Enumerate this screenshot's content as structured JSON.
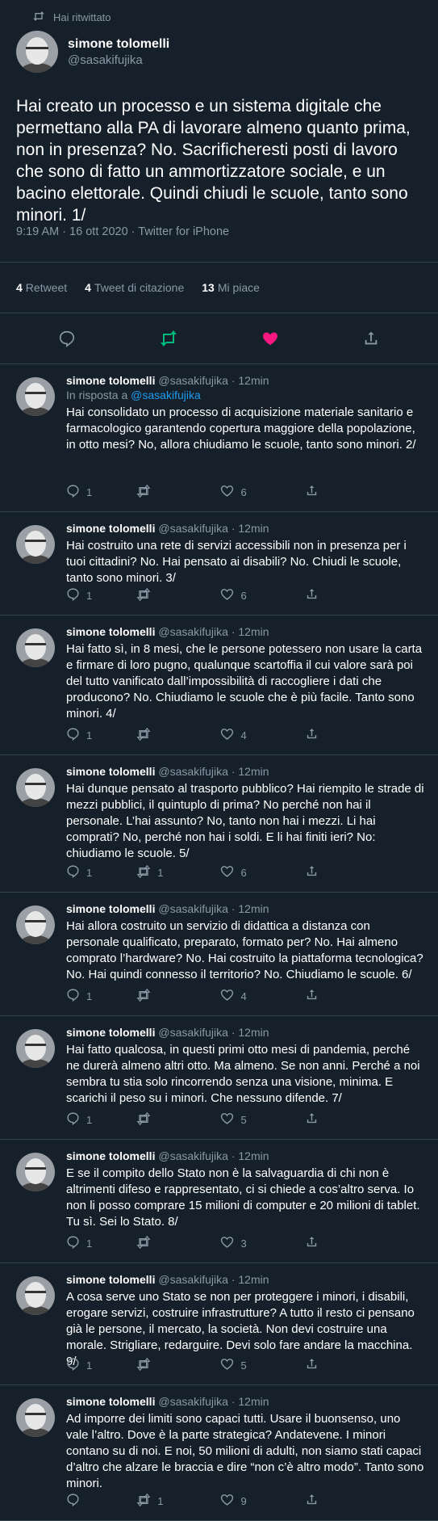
{
  "retweet_label": "Hai ritwittato",
  "main": {
    "name": "simone tolomelli",
    "handle": "@sasakifujika",
    "text": "Hai creato un processo e un sistema digitale che permettano alla PA di lavorare almeno quanto prima, non in presenza? No. Sacrificheresti posti di lavoro che sono di fatto un ammortizzatore sociale, e un bacino elettorale. Quindi chiudi le scuole, tanto sono minori. 1/",
    "meta": "9:19 AM · 16 ott 2020 · Twitter for iPhone",
    "retweets_count": "4",
    "retweets_label": "Retweet",
    "quotes_count": "4",
    "quotes_label": "Tweet di citazione",
    "likes_count": "13",
    "likes_label": "Mi piace"
  },
  "colors": {
    "background": "#15202b",
    "accent": "#1d9bf0",
    "like": "#f91880",
    "retweet_active": "#00ba7c"
  },
  "replies": [
    {
      "name": "simone tolomelli",
      "handle": "@sasakifujika",
      "time": "· 12min",
      "reply_to_prefix": "In risposta a",
      "reply_to_handle": "@sasakifujika",
      "text": "Hai consolidato un processo di acquisizione materiale sanitario e farmacologico garantendo copertura maggiore della popolazione, in otto mesi? No, allora chiudiamo le scuole, tanto sono minori. 2/",
      "replies": "1",
      "retweets": "",
      "likes": "6"
    },
    {
      "name": "simone tolomelli",
      "handle": "@sasakifujika",
      "time": "· 12min",
      "text": "Hai costruito una rete di servizi accessibili non in presenza per i tuoi cittadini? No. Hai pensato ai disabili? No.  Chiudi le scuole, tanto sono minori. 3/",
      "replies": "1",
      "retweets": "",
      "likes": "6"
    },
    {
      "name": "simone tolomelli",
      "handle": "@sasakifujika",
      "time": "· 12min",
      "text": "Hai fatto sì, in 8 mesi, che le persone potessero non usare la carta e firmare di loro pugno, qualunque scartoffia il cui valore sarà poi del tutto vanificato dall’impossibilità di raccogliere i dati che producono? No. Chiudiamo le scuole che è più facile. Tanto sono minori. 4/",
      "replies": "1",
      "retweets": "",
      "likes": "4"
    },
    {
      "name": "simone tolomelli",
      "handle": "@sasakifujika",
      "time": "· 12min",
      "text": "Hai dunque pensato al trasporto pubblico? Hai riempito le strade di mezzi pubblici, il quintuplo di prima? No perché non hai il personale. L’hai assunto? No, tanto non hai i mezzi. Li hai comprati? No, perché non hai i soldi. E li hai finiti ieri? No: chiudiamo le scuole. 5/",
      "replies": "1",
      "retweets": "1",
      "likes": "6"
    },
    {
      "name": "simone tolomelli",
      "handle": "@sasakifujika",
      "time": "· 12min",
      "text": "Hai allora costruito un servizio di didattica a distanza con personale qualificato, preparato, formato per? No. Hai almeno comprato l’hardware? No. Hai costruito la piattaforma tecnologica? No. Hai quindi connesso il territorio? No. Chiudiamo le scuole. 6/",
      "replies": "1",
      "retweets": "",
      "likes": "4"
    },
    {
      "name": "simone tolomelli",
      "handle": "@sasakifujika",
      "time": "· 12min",
      "text": "Hai fatto qualcosa, in questi primi otto mesi di pandemia, perché ne durerà almeno altri otto. Ma almeno. Se non anni. Perché a noi sembra tu stia solo rincorrendo senza una visione, minima. E scarichi il peso su i minori. Che nessuno difende. 7/",
      "replies": "1",
      "retweets": "",
      "likes": "5"
    },
    {
      "name": "simone tolomelli",
      "handle": "@sasakifujika",
      "time": "· 12min",
      "text": "E se il compito dello Stato non è la salvaguardia di chi non è altrimenti difeso e rappresentato, ci si chiede a cos’altro serva. Io non li posso comprare 15 milioni di computer e 20 milioni di tablet. Tu sì. Sei lo Stato. 8/",
      "replies": "1",
      "retweets": "",
      "likes": "3"
    },
    {
      "name": "simone tolomelli",
      "handle": "@sasakifujika",
      "time": "· 12min",
      "text": "A cosa serve uno Stato se non per proteggere i minori, i disabili, erogare servizi, costruire infrastrutture? A tutto il resto ci pensano già le persone, il mercato, la società. Non devi costruire una morale. Strigliare, redarguire. Devi solo fare andare la macchina. 9/",
      "replies": "1",
      "retweets": "",
      "likes": "5"
    },
    {
      "name": "simone tolomelli",
      "handle": "@sasakifujika",
      "time": "· 12min",
      "text": "Ad imporre dei limiti sono capaci tutti. Usare il buonsenso, uno vale l’altro. Dove è la parte strategica? Andatevene. I minori contano su di noi. E noi, 50 milioni di adulti, non siamo stati capaci d’altro che alzare le braccia e dire “non c’è altro modo”. Tanto sono minori.",
      "replies": "",
      "retweets": "1",
      "likes": "9"
    }
  ]
}
